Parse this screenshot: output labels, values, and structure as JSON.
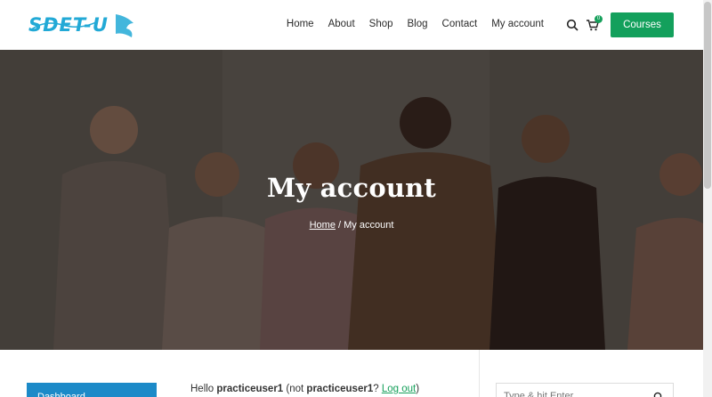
{
  "header": {
    "logo_text": "SDET-U",
    "nav": [
      "Home",
      "About",
      "Shop",
      "Blog",
      "Contact",
      "My account"
    ],
    "cart_count": "0",
    "courses_label": "Courses"
  },
  "hero": {
    "title": "My account",
    "breadcrumb_home": "Home",
    "breadcrumb_sep": " / ",
    "breadcrumb_current": "My account"
  },
  "account": {
    "sidebar_first_item": "Dashboard",
    "hello_prefix": "Hello ",
    "username": "practiceuser1",
    "not_prefix": " (not ",
    "username_again": "practiceuser1",
    "question": "? ",
    "logout": "Log out",
    "close_paren": ")"
  },
  "search": {
    "placeholder": "Type & hit Enter..."
  },
  "colors": {
    "brand_green": "#13a05c",
    "nav_blue": "#1c8ac8",
    "logo_cyan": "#22a9d6"
  }
}
